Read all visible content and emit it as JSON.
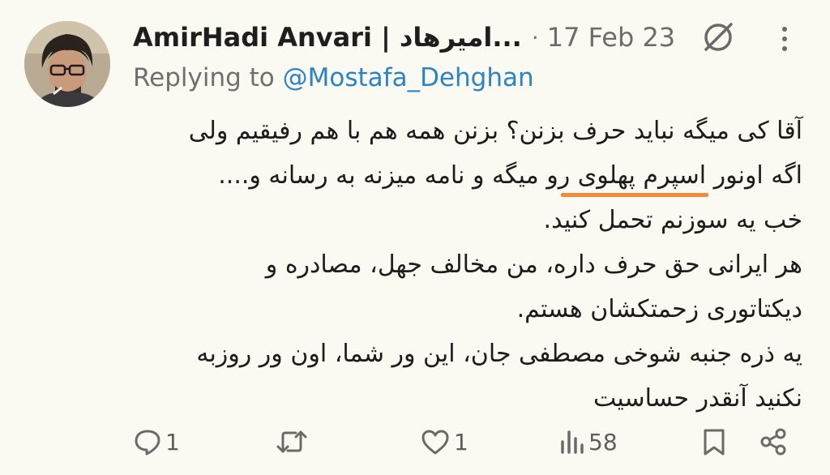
{
  "tweet": {
    "author": {
      "display_name": "AmirHadi Anvari | امیرهاد...",
      "avatar_icon": "user-avatar"
    },
    "meta": {
      "separator": "·",
      "timestamp": "17 Feb 23"
    },
    "replying": {
      "prefix": "Replying to",
      "handle": "@Mostafa_Dehghan"
    },
    "body_lines": [
      "آقا کی میگه نباید حرف بزنن؟ بزنن همه هم با هم رفیقیم ولی",
      "اگه اونور اسپرم پهلوی رو میگه و نامه میزنه به رسانه و....",
      "خب یه سوزنم تحمل کنید.",
      "هر ایرانی حق حرف داره، من مخالف جهل، مصادره و",
      "دیکتاتوری زحمتکشان هستم.",
      "یه ذره جنبه شوخی مصطفی جان، این ور شما، اون ور روزبه",
      "نکنید آنقدر حساسیت"
    ],
    "highlight_color": "#f08a3c",
    "actions": {
      "reply": {
        "icon": "reply-icon",
        "count": "1"
      },
      "retweet": {
        "icon": "retweet-icon",
        "count": ""
      },
      "like": {
        "icon": "heart-icon",
        "count": "1"
      },
      "views": {
        "icon": "views-icon",
        "count": "58"
      },
      "bookmark": {
        "icon": "bookmark-icon",
        "count": ""
      },
      "share": {
        "icon": "share-icon",
        "count": ""
      }
    }
  }
}
